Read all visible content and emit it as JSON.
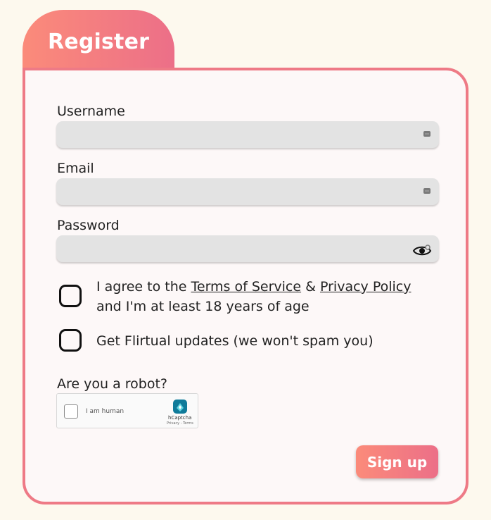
{
  "header": {
    "title": "Register"
  },
  "form": {
    "username_label": "Username",
    "username_value": "",
    "email_label": "Email",
    "email_value": "",
    "password_label": "Password",
    "password_value": "",
    "terms_prefix": "I agree to the ",
    "terms_link": "Terms of Service",
    "terms_and": " & ",
    "privacy_link": "Privacy Policy",
    "terms_suffix": " and I'm at least 18 years of age",
    "updates_label": "Get Flirtual updates (we won't spam you)",
    "robot_label": "Are you a robot?",
    "captcha_label": "I am human",
    "captcha_brand": "hCaptcha",
    "captcha_links": "Privacy - Terms",
    "signup_label": "Sign up"
  },
  "icons": {
    "field_menu": "dots-icon",
    "password_toggle": "eye-icon",
    "captcha_logo": "hcaptcha-logo"
  },
  "colors": {
    "accent_start": "#fb8b7a",
    "accent_end": "#ec6f88",
    "background": "#fdf9ee",
    "card_border": "#ee7a86"
  }
}
